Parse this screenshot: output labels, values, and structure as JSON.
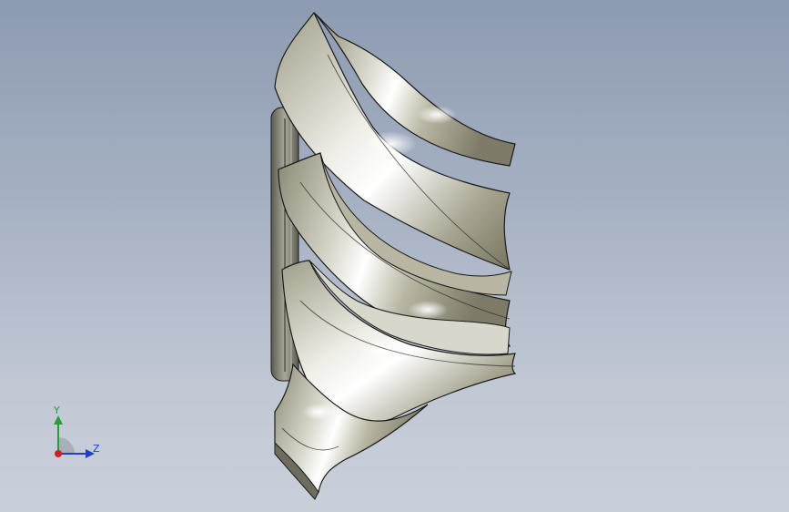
{
  "viewport": {
    "background_top": "#8d9bb1",
    "background_bottom": "#c9d0da"
  },
  "model": {
    "type": "axial-fan-impeller",
    "surface_color": "#c8c6b4",
    "shade_color": "#6e6c5e",
    "edge_color": "#1a1a1a"
  },
  "triad": {
    "y_label": "Y",
    "z_label": "Z",
    "y_color": "#2a9a3a",
    "z_color": "#2040c8",
    "x_color": "#d02020"
  }
}
